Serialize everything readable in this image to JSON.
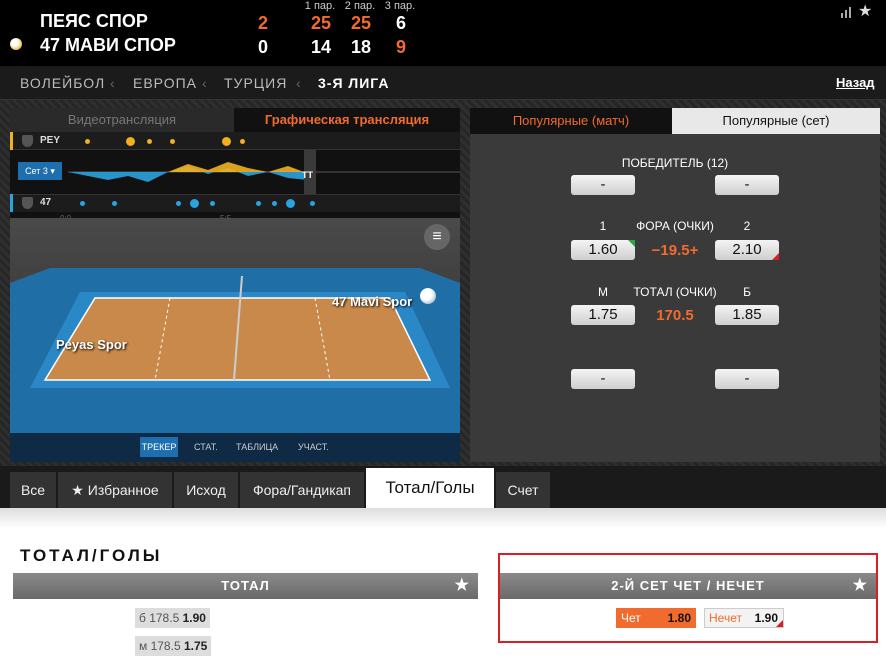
{
  "scoreboard": {
    "team1": "ПЕЯС СПОР",
    "team2": "47 МАВИ СПОР",
    "sets_label": [
      "1 пар.",
      "2 пар.",
      "3 пар."
    ],
    "team1_sets": "2",
    "team1_scores": [
      "25",
      "25",
      "6"
    ],
    "team2_sets": "0",
    "team2_scores": [
      "14",
      "18",
      "9"
    ]
  },
  "breadcrumb": {
    "items": [
      "ВОЛЕЙБОЛ",
      "ЕВРОПА",
      "ТУРЦИЯ",
      "3-Я ЛИГА"
    ],
    "back": "Назад"
  },
  "video": {
    "tab_video": "Видеотрансляция",
    "tab_graphic": "Графическая трансляция",
    "team1_short": "PEY",
    "team2_short": "47",
    "set_selector": "Сет 3",
    "time_start": "0:0",
    "time_mid": "5:5",
    "tt_label": "TT",
    "court_team1": "Peyas Spor",
    "court_team2": "47 Mavi Spor",
    "court_tabs": [
      "ТРЕКЕР",
      "СТАТ.",
      "ТАБЛИЦА",
      "УЧАСТ."
    ]
  },
  "odds_panel": {
    "tab_match": "Популярные (матч)",
    "tab_set": "Популярные (сет)",
    "winner_title": "ПОБЕДИТЕЛЬ (12)",
    "winner_1": "-",
    "winner_2": "-",
    "fora_label_1": "1",
    "fora_title": "ФОРА (ОЧКИ)",
    "fora_label_2": "2",
    "fora_1": "1.60",
    "fora_value": "−19.5+",
    "fora_2": "2.10",
    "total_label_m": "М",
    "total_title": "ТОТАЛ (ОЧКИ)",
    "total_label_b": "Б",
    "total_m": "1.75",
    "total_value": "170.5",
    "total_b": "1.85",
    "extra_1": "-",
    "extra_2": "-"
  },
  "tabs": {
    "all": "Все",
    "fav": "Избранное",
    "outcome": "Исход",
    "fora": "Фора/Гандикап",
    "total": "Тотал/Голы",
    "score": "Счет"
  },
  "section": {
    "title": "ТОТАЛ/ГОЛЫ",
    "total_header": "ТОТАЛ",
    "rows": [
      {
        "label": "б 178.5",
        "odd": "1.90"
      },
      {
        "label": "м 178.5",
        "odd": "1.75"
      }
    ],
    "parity_header": "2-Й СЕТ ЧЕТ / НЕЧЕТ",
    "even_label": "Чет",
    "even_odd": "1.80",
    "odd_label": "Нечет",
    "odd_odd": "1.90"
  },
  "colors": {
    "accent": "#f26b2e",
    "highlight": "#d81f26",
    "odd_green": "#2aa64a",
    "odd_red": "#d81f26"
  }
}
